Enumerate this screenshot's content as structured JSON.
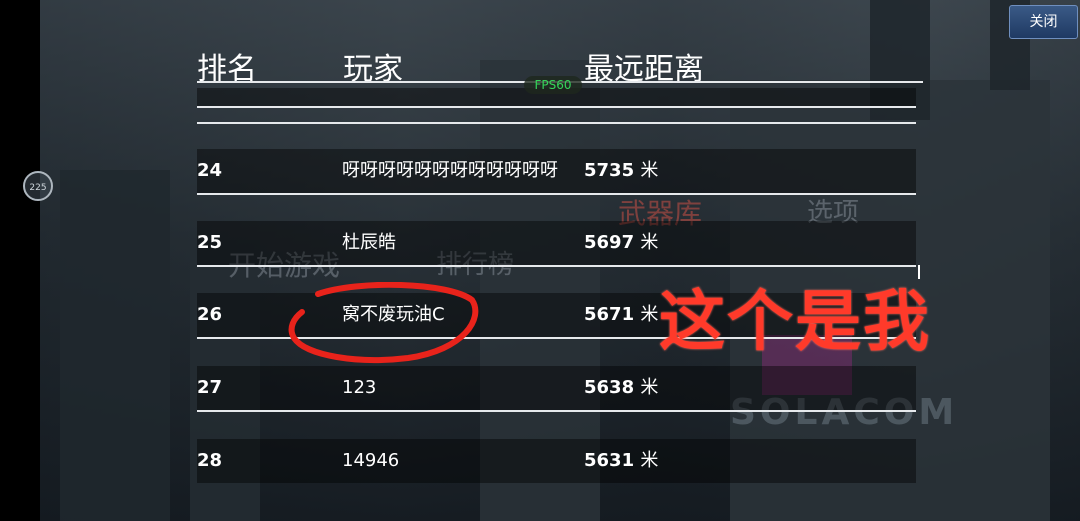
{
  "header": {
    "rank_label": "排名",
    "player_label": "玩家",
    "distance_label": "最远距离"
  },
  "close_button": "关闭",
  "fps_badge": "FPS60",
  "side_indicator": "225",
  "background_menu": {
    "armory": "武器库",
    "options": "选项",
    "start_game": "开始游戏",
    "leaderboard": "排行榜",
    "brand": "SOLACOM"
  },
  "rows": [
    {
      "rank": "24",
      "player": "呀呀呀呀呀呀呀呀呀呀呀呀",
      "distance": "5735",
      "unit": "米"
    },
    {
      "rank": "25",
      "player": "杜辰皓",
      "distance": "5697",
      "unit": "米"
    },
    {
      "rank": "26",
      "player": "窝不废玩油C",
      "distance": "5671",
      "unit": "米"
    },
    {
      "rank": "27",
      "player": "123",
      "distance": "5638",
      "unit": "米"
    },
    {
      "rank": "28",
      "player": "14946",
      "distance": "5631",
      "unit": "米"
    }
  ],
  "annotation_text": "这个是我",
  "colors": {
    "annotation": "#ff3a2a",
    "fps": "#35d55a",
    "close_button": "#2a4a78"
  }
}
